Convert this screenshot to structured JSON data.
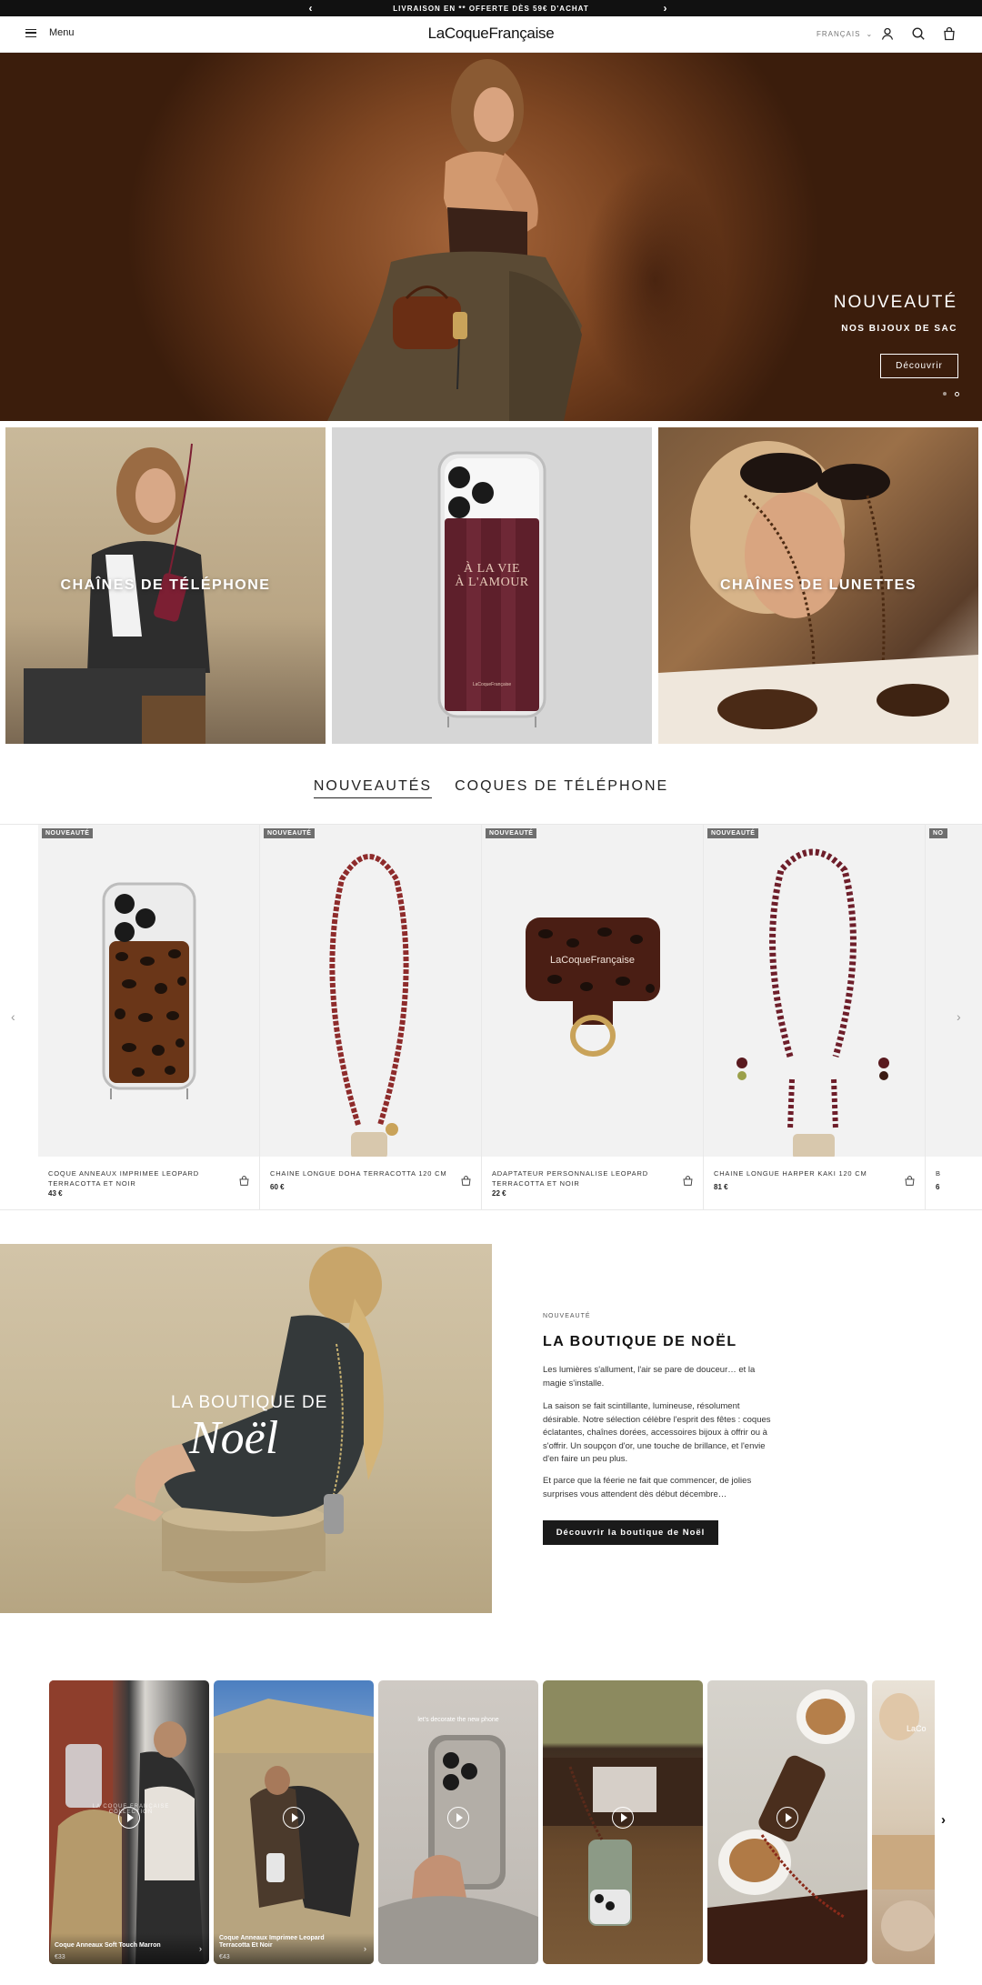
{
  "announcement": {
    "text": "LIVRAISON EN ** OFFERTE DÈS 59€ D'ACHAT",
    "prev": "‹",
    "next": "›"
  },
  "header": {
    "menu_label": "Menu",
    "logo": "LaCoqueFrançaise",
    "language": "FRANÇAIS",
    "lang_chevron": "⌄"
  },
  "icons": {
    "account": "user-icon",
    "search": "search-icon",
    "cart": "bag-icon"
  },
  "hero": {
    "title": "NOUVEAUTÉ",
    "subtitle": "NOS BIJOUX DE SAC",
    "cta": "Découvrir"
  },
  "tiles": [
    {
      "label": "CHAÎNES DE TÉLÉPHONE"
    },
    {
      "label": "",
      "case_text_1": "À LA VIE",
      "case_text_2": "À L'AMOUR",
      "case_brand": "LaCoqueFrançaise"
    },
    {
      "label": "CHAÎNES DE LUNETTES"
    }
  ],
  "tabs": [
    {
      "label": "NOUVEAUTÉS"
    },
    {
      "label": "COQUES DE TÉLÉPHONE"
    }
  ],
  "products": [
    {
      "badge": "NOUVEAUTÉ",
      "name": "COQUE ANNEAUX IMPRIMEE LEOPARD TERRACOTTA ET NOIR",
      "price": "43 €"
    },
    {
      "badge": "NOUVEAUTÉ",
      "name": "CHAINE LONGUE DOHA TERRACOTTA 120 CM",
      "price": "60 €"
    },
    {
      "badge": "NOUVEAUTÉ",
      "name": "ADAPTATEUR PERSONNALISE LEOPARD TERRACOTTA ET NOIR",
      "price": "22 €",
      "brand": "LaCoqueFrançaise"
    },
    {
      "badge": "NOUVEAUTÉ",
      "name": "CHAINE LONGUE HARPER KAKI 120 CM",
      "price": "81 €"
    },
    {
      "badge": "NO",
      "name": "B",
      "price": "6"
    }
  ],
  "carousel": {
    "prev": "‹",
    "next": "›"
  },
  "christmas": {
    "image_text_1": "LA BOUTIQUE DE",
    "image_text_2": "Noël",
    "kicker": "NOUVEAUTÉ",
    "title": "LA BOUTIQUE DE NOËL",
    "p1": "Les lumières s'allument, l'air se pare de douceur… et la magie s'installe.",
    "p2": "La saison se fait scintillante, lumineuse, résolument désirable. Notre sélection célèbre l'esprit des fêtes : coques éclatantes, chaînes dorées, accessoires bijoux à offrir ou à s'offrir. Un soupçon d'or, une touche de brillance, et l'envie d'en faire un peu plus.",
    "p3": "Et parce que la féerie ne fait que commencer, de jolies surprises vous attendent dès début décembre…",
    "cta": "Découvrir la boutique de Noël"
  },
  "videos": [
    {
      "title": "Coque Anneaux Soft Touch Marron",
      "price": "€33",
      "overlay": "LA COQUE FRANÇAISE COLLECTION"
    },
    {
      "title": "Coque Anneaux Imprimee Leopard Terracotta Et Noir",
      "price": "€43"
    },
    {
      "title": "",
      "price": "",
      "overlay": "let's decorate the new phone"
    },
    {
      "title": "",
      "price": ""
    },
    {
      "title": "",
      "price": ""
    },
    {
      "title": "",
      "price": "",
      "overlay": "LaCo"
    }
  ],
  "video_next": "›"
}
